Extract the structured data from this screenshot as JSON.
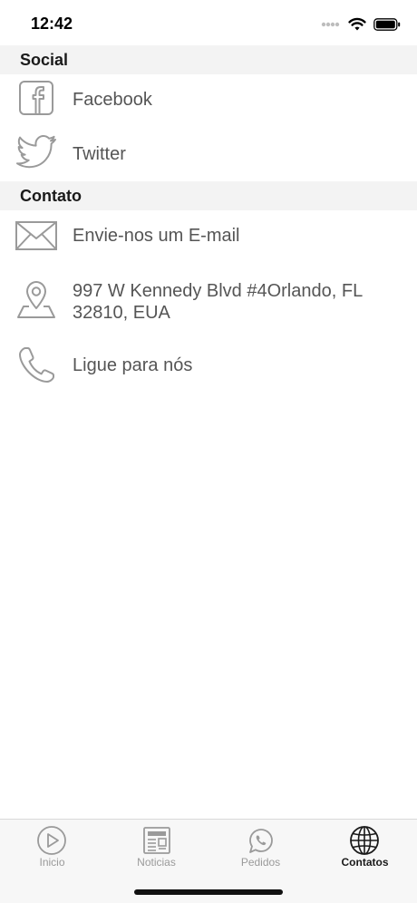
{
  "status_bar": {
    "time": "12:42",
    "icons": [
      "signal-dots-icon",
      "wifi-icon",
      "battery-icon"
    ]
  },
  "sections": [
    {
      "title": "Social",
      "items": [
        {
          "label": "Facebook",
          "icon": "facebook-icon"
        },
        {
          "label": "Twitter",
          "icon": "twitter-icon"
        }
      ]
    },
    {
      "title": "Contato",
      "items": [
        {
          "label": "Envie-nos um E-mail",
          "icon": "mail-icon"
        },
        {
          "label": "997 W Kennedy Blvd #4Orlando, FL 32810, EUA",
          "icon": "map-pin-icon"
        },
        {
          "label": "Ligue para nós",
          "icon": "phone-icon"
        }
      ]
    }
  ],
  "tab_bar": {
    "tabs": [
      {
        "label": "Inicio",
        "icon": "play-circle-icon",
        "active": false
      },
      {
        "label": "Noticias",
        "icon": "newspaper-icon",
        "active": false
      },
      {
        "label": "Pedidos",
        "icon": "whatsapp-icon",
        "active": false
      },
      {
        "label": "Contatos",
        "icon": "globe-icon",
        "active": true
      }
    ]
  },
  "colors": {
    "icon_gray": "#9a9a9a",
    "active_tab": "#1a1a1a",
    "section_bg": "#f3f3f3"
  }
}
